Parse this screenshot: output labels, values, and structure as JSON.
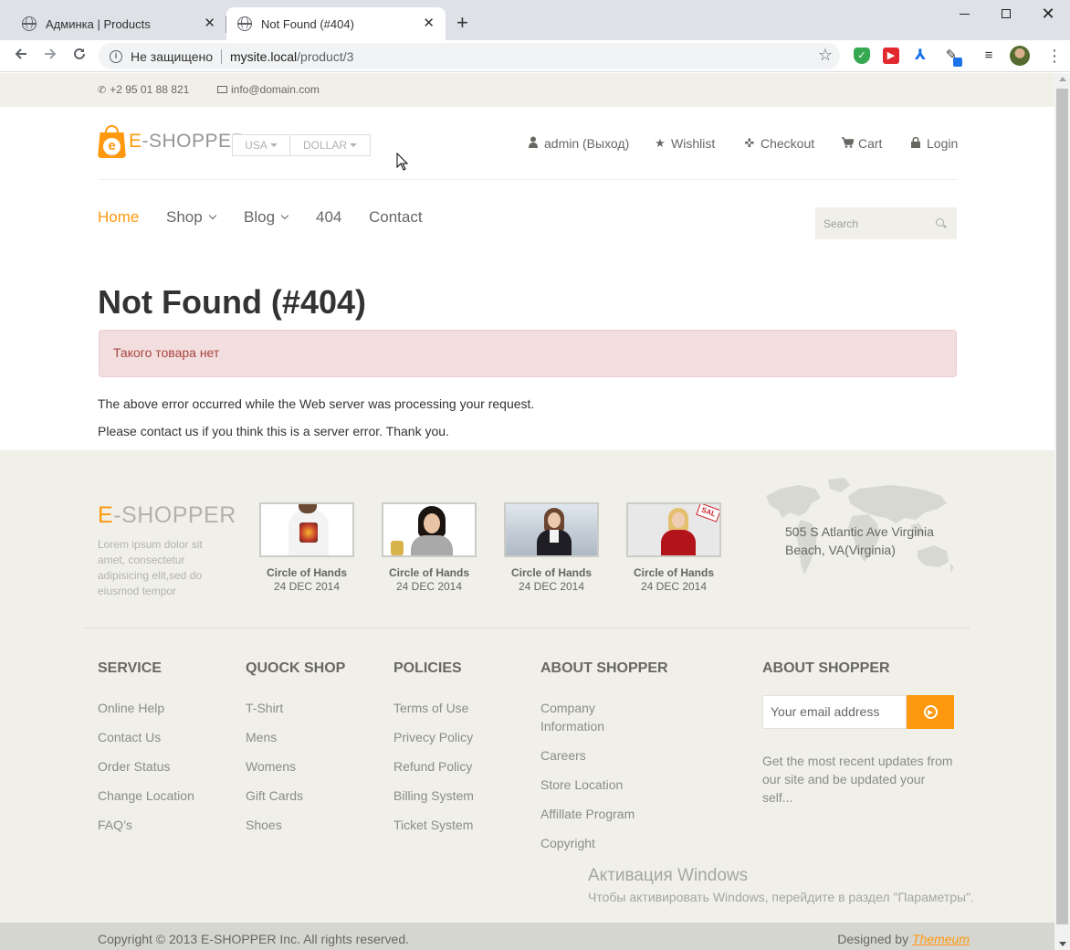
{
  "browser": {
    "tabs": [
      {
        "title": "Админка | Products",
        "active": false
      },
      {
        "title": "Not Found (#404)",
        "active": true
      }
    ],
    "security_label": "Не защищено",
    "url_host": "mysite.local",
    "url_path": "/product/3"
  },
  "topbar": {
    "phone": "+2 95 01 88 821",
    "email": "info@domain.com"
  },
  "header": {
    "logo_e": "E",
    "logo_rest": "-SHOPPER",
    "country": "USA",
    "currency": "DOLLAR",
    "usermenu": [
      {
        "label": "admin (Выход)",
        "icon": "user-icon"
      },
      {
        "label": "Wishlist",
        "icon": "star-icon"
      },
      {
        "label": "Checkout",
        "icon": "crosshairs-icon"
      },
      {
        "label": "Cart",
        "icon": "cart-icon"
      },
      {
        "label": "Login",
        "icon": "lock-icon"
      }
    ]
  },
  "nav": {
    "items": [
      "Home",
      "Shop",
      "Blog",
      "404",
      "Contact"
    ],
    "active": "Home",
    "search_placeholder": "Search"
  },
  "error": {
    "title": "Not Found (#404)",
    "message": "Такого товара нет",
    "p1": "The above error occurred while the Web server was processing your request.",
    "p2": "Please contact us if you think this is a server error. Thank you."
  },
  "footer": {
    "logo_e": "E",
    "logo_rest": "-SHOPPER",
    "lorem": "Lorem ipsum dolor sit amet, consectetur adipisicing elit,sed do eiusmod tempor",
    "videos": [
      {
        "title": "Circle of Hands",
        "date": "24 DEC 2014"
      },
      {
        "title": "Circle of Hands",
        "date": "24 DEC 2014"
      },
      {
        "title": "Circle of Hands",
        "date": "24 DEC 2014"
      },
      {
        "title": "Circle of Hands",
        "date": "24 DEC 2014"
      }
    ],
    "address": "505 S Atlantic Ave Virginia Beach, VA(Virginia)",
    "columns": [
      {
        "title": "SERVICE",
        "links": [
          "Online Help",
          "Contact Us",
          "Order Status",
          "Change Location",
          "FAQ’s"
        ]
      },
      {
        "title": "QUOCK SHOP",
        "links": [
          "T-Shirt",
          "Mens",
          "Womens",
          "Gift Cards",
          "Shoes"
        ]
      },
      {
        "title": "POLICIES",
        "links": [
          "Terms of Use",
          "Privecy Policy",
          "Refund Policy",
          "Billing System",
          "Ticket System"
        ]
      },
      {
        "title": "ABOUT SHOPPER",
        "links": [
          "Company Information",
          "Careers",
          "Store Location",
          "Affillate Program",
          "Copyright"
        ]
      }
    ],
    "subscribe": {
      "title": "ABOUT SHOPPER",
      "placeholder": "Your email address",
      "note": "Get the most recent updates from our site and be updated your self..."
    },
    "copyright": "Copyright © 2013 E-SHOPPER Inc. All rights reserved.",
    "designed_by": "Designed by",
    "designer": "Themeum"
  },
  "os_watermark": {
    "title": "Активация Windows",
    "subtitle": "Чтобы активировать Windows, перейдите в раздел \"Параметры\"."
  },
  "colors": {
    "accent": "#FE980F",
    "footer_bg": "#F0F0E9",
    "alert_bg": "#F2DEDE",
    "alert_text": "#A94442"
  }
}
